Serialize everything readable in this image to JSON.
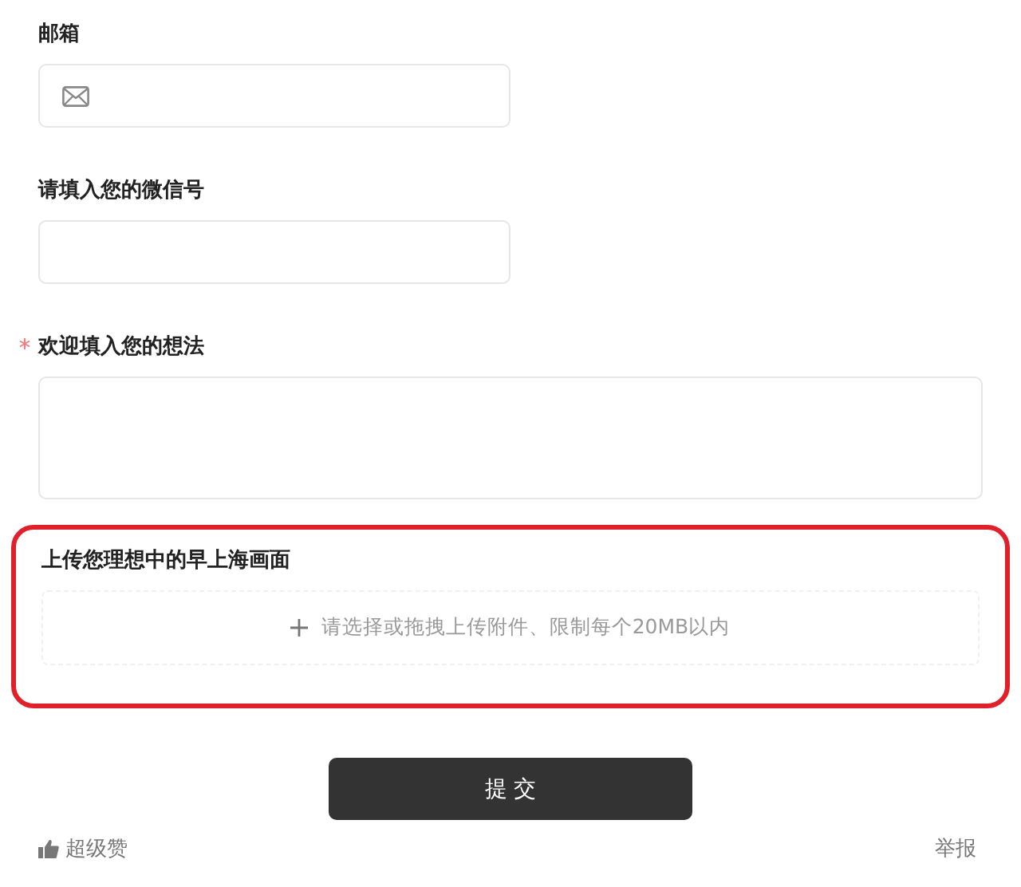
{
  "fields": [
    {
      "kind": "email",
      "label": "邮箱",
      "required": false
    },
    {
      "kind": "text",
      "label": "请填入您的微信号",
      "required": false
    },
    {
      "kind": "textarea",
      "label": "欢迎填入您的想法",
      "required": true
    }
  ],
  "upload": {
    "label": "上传您理想中的早上海画面",
    "hint": "请选择或拖拽上传附件、限制每个20MB以内",
    "highlighted": true
  },
  "submit": "提 交",
  "footer": {
    "like": "超级赞",
    "report": "举报"
  }
}
